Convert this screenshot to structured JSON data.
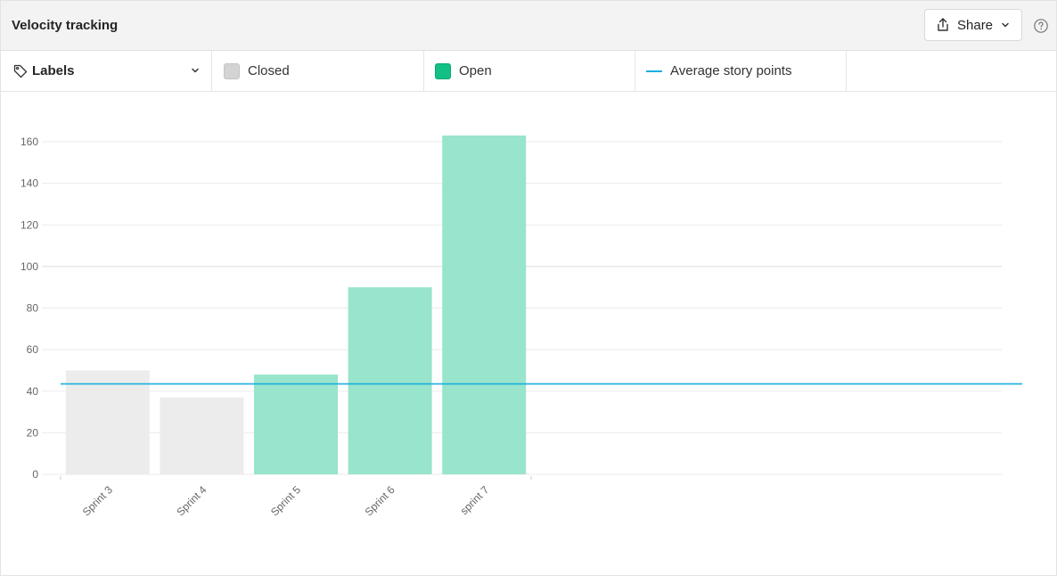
{
  "header": {
    "title": "Velocity tracking",
    "share_label": "Share"
  },
  "legend": {
    "labels_label": "Labels",
    "items": [
      {
        "label": "Closed",
        "color": "#d4d4d4"
      },
      {
        "label": "Open",
        "color": "#12bf85"
      },
      {
        "label": "Average story points",
        "color": "#1ab0e0"
      }
    ]
  },
  "icons": {
    "share": "share-icon",
    "help": "help-icon",
    "tag": "tag-icon",
    "chevron": "chevron-down-icon"
  },
  "colors": {
    "closed_bar": "#ececec",
    "open_bar": "#98e4cc",
    "average_line": "#1ab0e0"
  },
  "chart_data": {
    "type": "bar",
    "categories": [
      "Sprint 3",
      "Sprint 4",
      "Sprint 5",
      "Sprint 6",
      "sprint 7"
    ],
    "series": [
      {
        "name": "Closed",
        "values": [
          50,
          37,
          null,
          null,
          null
        ]
      },
      {
        "name": "Open",
        "values": [
          null,
          null,
          48,
          90,
          163
        ]
      }
    ],
    "average": {
      "name": "Average story points",
      "value": 43.5
    },
    "yticks": [
      0,
      20,
      40,
      60,
      80,
      100,
      120,
      140,
      160
    ],
    "ylim": [
      0,
      160
    ],
    "grid": true,
    "legend": "top",
    "xlabel": "",
    "ylabel": "",
    "title": ""
  }
}
